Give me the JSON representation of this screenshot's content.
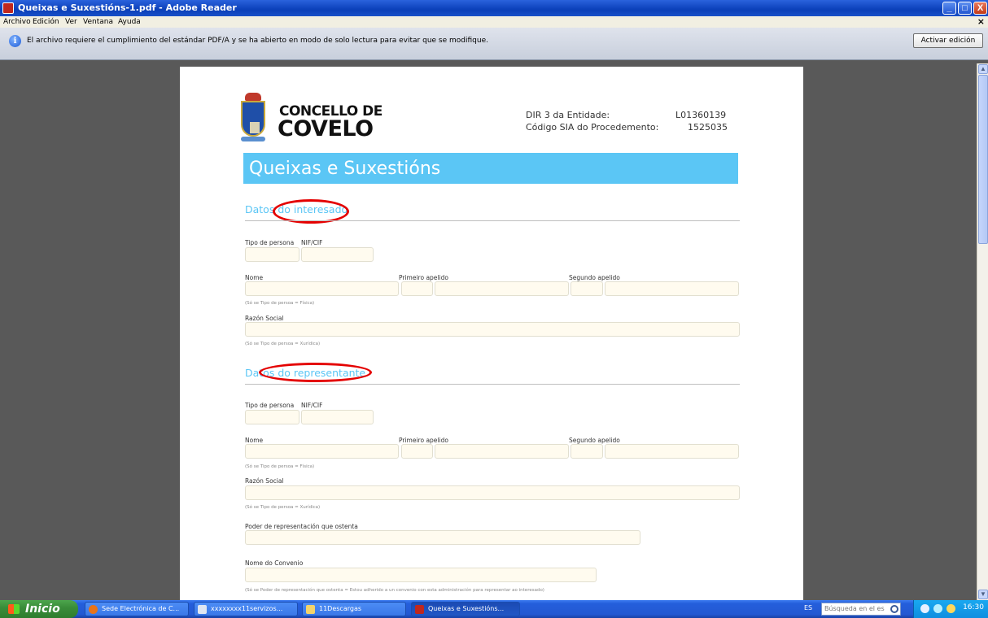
{
  "window": {
    "title": "Queixas e Suxestións-1.pdf - Adobe Reader",
    "controls": [
      "_",
      "□",
      "X"
    ]
  },
  "menu": {
    "items": [
      "Archivo",
      "Edición",
      "Ver",
      "Ventana",
      "Ayuda"
    ],
    "close": "×"
  },
  "infobar": {
    "icon": "i",
    "message": "El archivo requiere el cumplimiento del estándar PDF/A y se ha abierto en modo de solo lectura para evitar que se modifique.",
    "button": "Activar edición"
  },
  "document": {
    "org_line1": "CONCELLO DE",
    "org_line2": "COVELO",
    "meta": {
      "dir3_label": "DIR 3 da Entidade:",
      "dir3_value": "L01360139",
      "sia_label": "Código SIA do Procedemento:",
      "sia_value": "1525035"
    },
    "banner": "Queixas e Suxestións",
    "section_interesado": {
      "title": "Datos do interesado",
      "tipo_label": "Tipo de persona",
      "nif_label": "NIF/CIF",
      "nome_label": "Nome",
      "primeiro_label": "Primeiro apelido",
      "segundo_label": "Segundo apelido",
      "hint_fisica": "(Só se Tipo de persoa = Física)",
      "razon_label": "Razón Social",
      "hint_xuridica": "(Só se Tipo de persoa = Xurídica)"
    },
    "section_representante": {
      "title": "Datos do representante",
      "tipo_label": "Tipo de persona",
      "nif_label": "NIF/CIF",
      "nome_label": "Nome",
      "primeiro_label": "Primeiro apelido",
      "segundo_label": "Segundo apelido",
      "hint_fisica": "(Só se Tipo de persoa = Física)",
      "razon_label": "Razón Social",
      "hint_xuridica": "(Só se Tipo de persoa = Xurídica)",
      "poder_label": "Poder de representación que ostenta",
      "convenio_label": "Nome do Convenio",
      "hint_convenio": "(Só se Poder de representación que ostenta = Estou adherido a un convenio con esta administración para representar ao interesado)"
    }
  },
  "taskbar": {
    "start": "Inicio",
    "tasks": [
      {
        "label": "Sede Electrónica de C...",
        "color": "#e8731a"
      },
      {
        "label": "xxxxxxxx11servizos...",
        "color": "#dfe6f2"
      },
      {
        "label": "11Descargas",
        "color": "#f3d36b"
      },
      {
        "label": "Queixas e Suxestións...",
        "color": "#c0281e"
      }
    ],
    "language": "ES",
    "search_placeholder": "Búsqueda en el escritorio",
    "clock": "16:30"
  },
  "colors": {
    "banner": "#5bc6f5",
    "section_title": "#5bc6f5",
    "annotation": "#e40000",
    "field_bg": "#fffbef"
  }
}
